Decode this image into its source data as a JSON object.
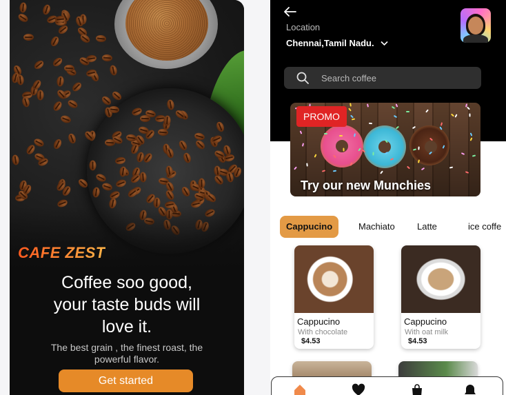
{
  "left_screen": {
    "brand": "CAFE ZEST",
    "headline": "Coffee soo good,\nyour taste buds will\nlove it.",
    "subline": "The best grain , the finest roast, the\npowerful flavor.",
    "cta_label": "Get started"
  },
  "right_screen": {
    "back_icon": "arrow-left-icon",
    "location_label": "Location",
    "location_value": "Chennai,Tamil Nadu.",
    "location_chevron": "chevron-down-icon",
    "avatar": "user-avatar",
    "search": {
      "placeholder": "Search coffee",
      "icon": "search-icon"
    },
    "promo": {
      "badge": "PROMO",
      "text": "Try our new Munchies"
    },
    "tabs": [
      {
        "label": "Cappucino",
        "active": true
      },
      {
        "label": "Machiato",
        "active": false
      },
      {
        "label": "Latte",
        "active": false
      },
      {
        "label": "ice coffe",
        "active": false
      }
    ],
    "products": [
      {
        "name": "Cappucino",
        "desc": "With chocolate",
        "price": "$4.53"
      },
      {
        "name": "Cappucino",
        "desc": "With oat milk",
        "price": "$4.53"
      }
    ],
    "bottom_nav": [
      "home-icon",
      "heart-icon",
      "bag-icon",
      "bell-icon"
    ]
  },
  "colors": {
    "accent": "#e68a28",
    "tab_active": "#e39a45",
    "promo_badge": "#e02424",
    "dark_bg": "#000000"
  }
}
